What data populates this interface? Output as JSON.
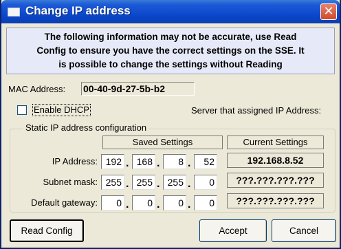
{
  "window": {
    "title": "Change IP address",
    "close_glyph": "✕",
    "icon": "window-app-icon"
  },
  "notice": {
    "line1": "The following information may not be accurate, use Read",
    "line2": "Config to ensure you have the correct settings on the SSE. It",
    "line3": "is possible to change the settings without Reading"
  },
  "mac": {
    "label": "MAC Address:",
    "value": "00-40-9d-27-5b-b2"
  },
  "dhcp": {
    "label": "Enable DHCP",
    "checked": false
  },
  "server_label": "Server that assigned IP Address:",
  "static_group": {
    "legend": "Static IP address configuration",
    "saved_header": "Saved Settings",
    "current_header": "Current Settings",
    "rows": [
      {
        "label": "IP Address:",
        "octets": [
          "192",
          "168",
          "8",
          "52"
        ],
        "current": "192.168.8.52"
      },
      {
        "label": "Subnet mask:",
        "octets": [
          "255",
          "255",
          "255",
          "0"
        ],
        "current": "???.???.???.???"
      },
      {
        "label": "Default gateway:",
        "octets": [
          "0",
          "0",
          "0",
          "0"
        ],
        "current": "???.???.???.???"
      }
    ]
  },
  "buttons": {
    "read_config": "Read Config",
    "accept": "Accept",
    "cancel": "Cancel"
  }
}
